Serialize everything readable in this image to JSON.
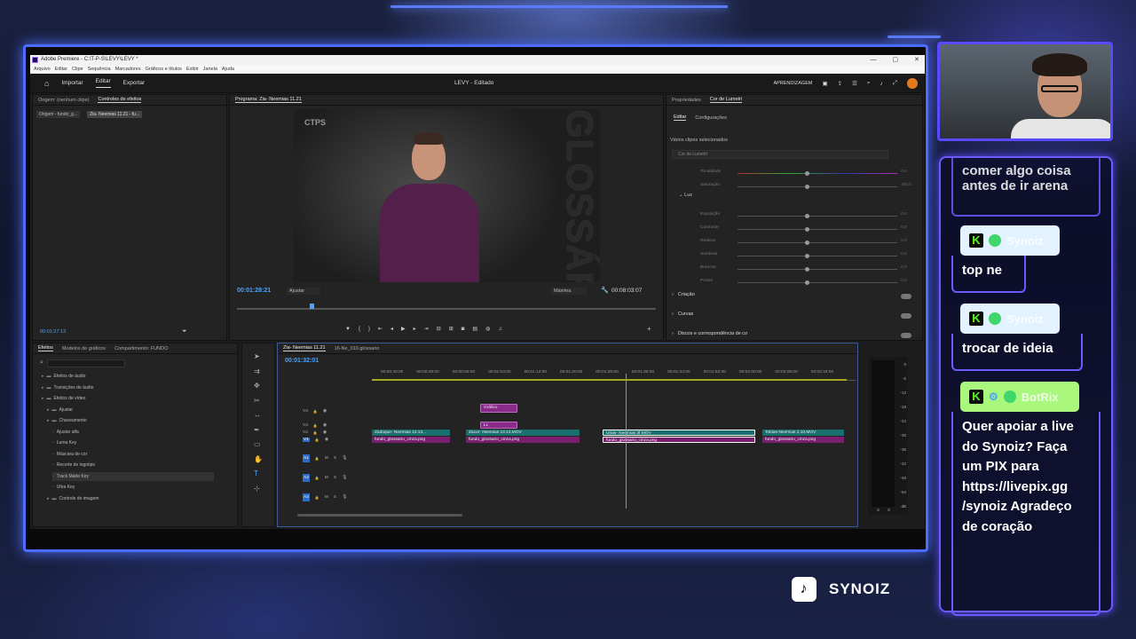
{
  "window": {
    "title": "Adobe Premiere - C:\\T-P-S\\LEVY\\LEVY *",
    "controls": [
      "—",
      "▢",
      "✕"
    ]
  },
  "menu": [
    "Arquivo",
    "Editar",
    "Clipe",
    "Sequência",
    "Marcadores",
    "Gráficos e títulos",
    "Exibir",
    "Janela",
    "Ajuda"
  ],
  "header": {
    "modes": [
      "Importar",
      "Editar",
      "Exportar"
    ],
    "active_mode": "Editar",
    "project_title": "LEVY - Editado",
    "learning": "APRENDIZAGEM"
  },
  "source_panel": {
    "tabs": [
      "Origem: (nenhum clipe)",
      "Controles de efeitos"
    ],
    "clip_a": "Origem - fundo_g...",
    "clip_b": "Zia- Neemias 11.21 - fu...",
    "timecode": "00:01:27:13"
  },
  "program_panel": {
    "title": "Programa: Zia- Neemias 11.21",
    "overlay_text": "GLOSSÁRIO",
    "logo_text": "CTPS",
    "current_time": "00:01:28:21",
    "fit": "Ajustar",
    "quality": "Máxima",
    "duration": "00:08:03:07"
  },
  "lumetri": {
    "tabs": [
      "Propriedades",
      "Cor de Lumetri"
    ],
    "subtabs": [
      "Editar",
      "Configurações"
    ],
    "selection_note": "Vários clipes selecionados",
    "dropdown": "Cor de Lumetri",
    "sliders": [
      "Tonalidade",
      "Saturação"
    ],
    "luz_label": "Luz",
    "luz_sliders": [
      "Exposição",
      "Contraste",
      "Realces",
      "Sombras",
      "Brancos",
      "Pretos"
    ],
    "slider_values": [
      "0,0",
      "100,0",
      "0,0",
      "0,0",
      "0,0",
      "0,0",
      "0,0",
      "0,0"
    ],
    "sections": [
      "Criação",
      "Curvas",
      "Discos e correspondência de co"
    ]
  },
  "effects_panel": {
    "tabs": [
      "Efeitos",
      "Modelos de gráficos",
      "Compartimento: FUNDO"
    ],
    "tree": [
      {
        "label": "Efeitos de áudio",
        "depth": 1
      },
      {
        "label": "Transições de áudio",
        "depth": 1
      },
      {
        "label": "Efeitos de vídeo",
        "depth": 1
      },
      {
        "label": "Ajustar",
        "depth": 2
      },
      {
        "label": "Chaveamento",
        "depth": 2
      },
      {
        "label": "Ajustar alfa",
        "depth": 3
      },
      {
        "label": "Luma Key",
        "depth": 3
      },
      {
        "label": "Máscara de cor",
        "depth": 3
      },
      {
        "label": "Recorte de logotipo",
        "depth": 3
      },
      {
        "label": "Track Matte Key",
        "depth": 3
      },
      {
        "label": "Ultra Key",
        "depth": 3
      },
      {
        "label": "Controle de imagem",
        "depth": 2
      }
    ]
  },
  "timeline": {
    "tabs": [
      "Zia- Neemias 11.21",
      "16-Ne_010.glossario"
    ],
    "timecode": "00:01:32:01",
    "ruler": [
      "00:00:40:00",
      "00:00:48:00",
      "00:00:56:00",
      "00:01:04:00",
      "00:01:12:00",
      "00:01:20:00",
      "00:01:28:00",
      "00:01:36:00",
      "00:01:44:00",
      "00:01:52:00",
      "00:02:00:00",
      "00:02:08:00",
      "00:02:16:00"
    ],
    "video_tracks": [
      "V4",
      "V3",
      "V2",
      "V1"
    ],
    "audio_tracks": [
      "A1",
      "A2",
      "A3"
    ],
    "v2_clips": [
      "Zadoque- Neemias 13.13...",
      "Zacur- Neemias 13.13.MOV",
      "Urias- Neemias 3f.MOV",
      "Tobias-Neemias 2.10.MOV"
    ],
    "v1_clips": [
      "fundo_glossario_cinza.png",
      "fundo_glossario_cinza.png",
      "fundo_glossario_cinza.png",
      "fundo_glossario_cinza.png"
    ],
    "graphic_clip": "Gráfico",
    "graphic_sub": "LL",
    "fx": "fx"
  },
  "audio_meter": {
    "scale": [
      "0",
      "-6",
      "-12",
      "-18",
      "-24",
      "-30",
      "-36",
      "-42",
      "-48",
      "-54",
      "dB"
    ],
    "channels": [
      "S",
      "S"
    ]
  },
  "chat": {
    "top_message": "comer algo coisa antes de ir arena",
    "messages": [
      {
        "user": "Synoiz",
        "text": "top ne"
      },
      {
        "user": "Synoiz",
        "text": "trocar de ideia"
      },
      {
        "user": "BotRix",
        "text": "Quer apoiar a live do Synoiz? Faça um PIX para https://livepix.gg /synoiz Agradeço de coração"
      }
    ]
  },
  "brand": {
    "name": "SYNOIZ",
    "tiktok_glyph": "♪"
  },
  "colors": {
    "accent_blue": "#4aa3ff",
    "kick_green": "#53fc18",
    "neon": "#5a4aff"
  }
}
